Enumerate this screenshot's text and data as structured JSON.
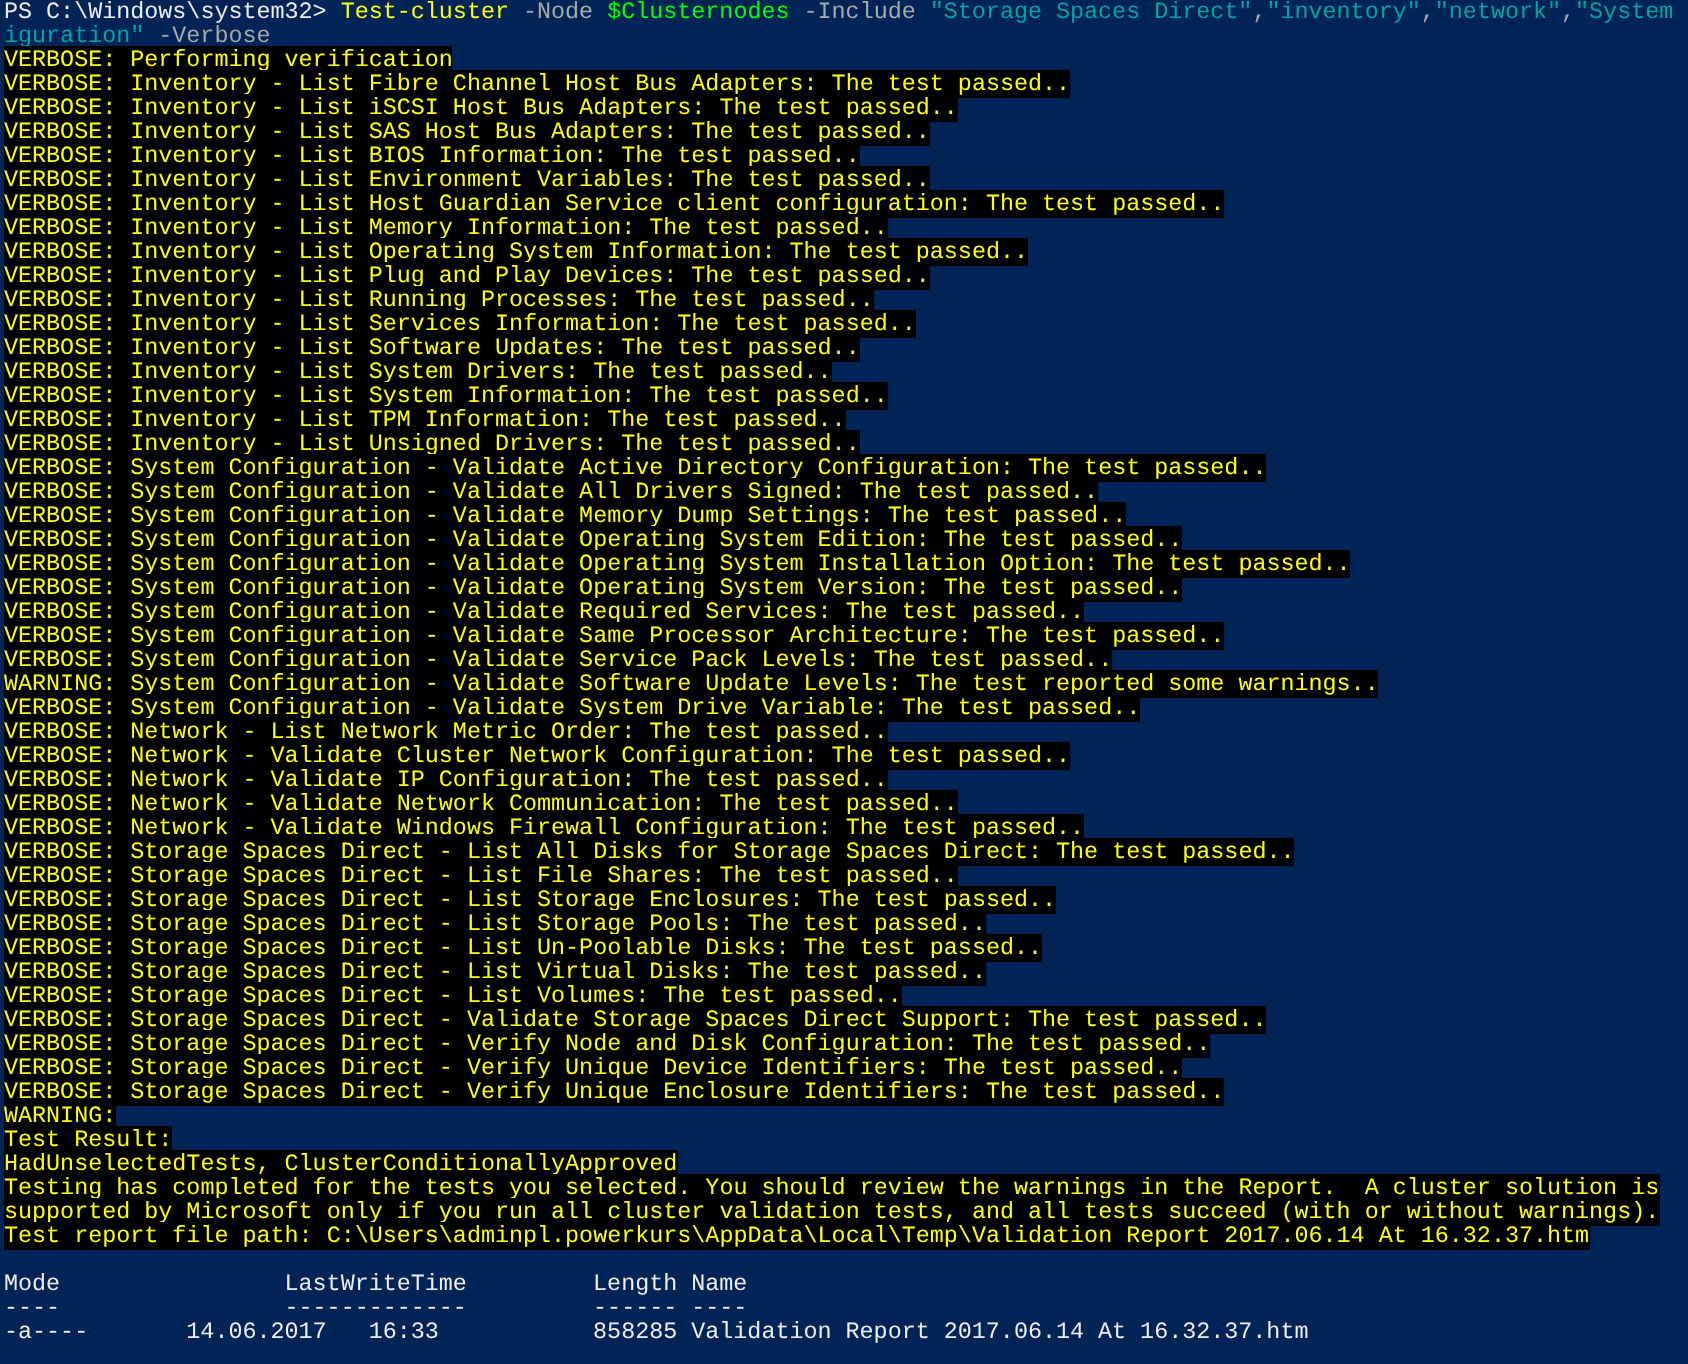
{
  "command_lines": [
    {
      "tokens": [
        {
          "kind": "prompt",
          "text": "PS C:\\Windows\\system32>"
        },
        {
          "kind": "command",
          "text": "Test-cluster"
        },
        {
          "kind": "parameter",
          "text": "-Node"
        },
        {
          "kind": "variable",
          "text": "$Clusternodes"
        },
        {
          "kind": "parameter",
          "text": "-Include"
        },
        {
          "kind": "string",
          "text": "\"Storage Spaces Direct\""
        },
        {
          "kind": "operator",
          "text": ","
        },
        {
          "kind": "string",
          "text": "\"inventory\""
        },
        {
          "kind": "operator",
          "text": ","
        },
        {
          "kind": "string",
          "text": "\"network\""
        },
        {
          "kind": "operator",
          "text": ","
        },
        {
          "kind": "string",
          "text": "\"System"
        }
      ]
    },
    {
      "tokens": [
        {
          "kind": "string",
          "text": "iguration\""
        },
        {
          "kind": "parameter",
          "text": "-Verbose"
        }
      ]
    }
  ],
  "output": [
    "VERBOSE: Performing verification",
    "VERBOSE: Inventory - List Fibre Channel Host Bus Adapters: The test passed..",
    "VERBOSE: Inventory - List iSCSI Host Bus Adapters: The test passed..",
    "VERBOSE: Inventory - List SAS Host Bus Adapters: The test passed..",
    "VERBOSE: Inventory - List BIOS Information: The test passed..",
    "VERBOSE: Inventory - List Environment Variables: The test passed..",
    "VERBOSE: Inventory - List Host Guardian Service client configuration: The test passed..",
    "VERBOSE: Inventory - List Memory Information: The test passed..",
    "VERBOSE: Inventory - List Operating System Information: The test passed..",
    "VERBOSE: Inventory - List Plug and Play Devices: The test passed..",
    "VERBOSE: Inventory - List Running Processes: The test passed..",
    "VERBOSE: Inventory - List Services Information: The test passed..",
    "VERBOSE: Inventory - List Software Updates: The test passed..",
    "VERBOSE: Inventory - List System Drivers: The test passed..",
    "VERBOSE: Inventory - List System Information: The test passed..",
    "VERBOSE: Inventory - List TPM Information: The test passed..",
    "VERBOSE: Inventory - List Unsigned Drivers: The test passed..",
    "VERBOSE: System Configuration - Validate Active Directory Configuration: The test passed..",
    "VERBOSE: System Configuration - Validate All Drivers Signed: The test passed..",
    "VERBOSE: System Configuration - Validate Memory Dump Settings: The test passed..",
    "VERBOSE: System Configuration - Validate Operating System Edition: The test passed..",
    "VERBOSE: System Configuration - Validate Operating System Installation Option: The test passed..",
    "VERBOSE: System Configuration - Validate Operating System Version: The test passed..",
    "VERBOSE: System Configuration - Validate Required Services: The test passed..",
    "VERBOSE: System Configuration - Validate Same Processor Architecture: The test passed..",
    "VERBOSE: System Configuration - Validate Service Pack Levels: The test passed..",
    "WARNING: System Configuration - Validate Software Update Levels: The test reported some warnings..",
    "VERBOSE: System Configuration - Validate System Drive Variable: The test passed..",
    "VERBOSE: Network - List Network Metric Order: The test passed..",
    "VERBOSE: Network - Validate Cluster Network Configuration: The test passed..",
    "VERBOSE: Network - Validate IP Configuration: The test passed..",
    "VERBOSE: Network - Validate Network Communication: The test passed..",
    "VERBOSE: Network - Validate Windows Firewall Configuration: The test passed..",
    "VERBOSE: Storage Spaces Direct - List All Disks for Storage Spaces Direct: The test passed..",
    "VERBOSE: Storage Spaces Direct - List File Shares: The test passed..",
    "VERBOSE: Storage Spaces Direct - List Storage Enclosures: The test passed..",
    "VERBOSE: Storage Spaces Direct - List Storage Pools: The test passed..",
    "VERBOSE: Storage Spaces Direct - List Un-Poolable Disks: The test passed..",
    "VERBOSE: Storage Spaces Direct - List Virtual Disks: The test passed..",
    "VERBOSE: Storage Spaces Direct - List Volumes: The test passed..",
    "VERBOSE: Storage Spaces Direct - Validate Storage Spaces Direct Support: The test passed..",
    "VERBOSE: Storage Spaces Direct - Verify Node and Disk Configuration: The test passed..",
    "VERBOSE: Storage Spaces Direct - Verify Unique Device Identifiers: The test passed..",
    "VERBOSE: Storage Spaces Direct - Verify Unique Enclosure Identifiers: The test passed..",
    "WARNING:",
    "Test Result:",
    "HadUnselectedTests, ClusterConditionallyApproved",
    "Testing has completed for the tests you selected. You should review the warnings in the Report.  A cluster solution is",
    "supported by Microsoft only if you run all cluster validation tests, and all tests succeed (with or without warnings).",
    "Test report file path: C:\\Users\\adminpl.powerkurs\\AppData\\Local\\Temp\\Validation Report 2017.06.14 At 16.32.37.htm"
  ],
  "table": {
    "columns": [
      "Mode",
      "LastWriteTime",
      "Length",
      "Name"
    ],
    "separators": [
      "----",
      "-------------",
      "------",
      "----"
    ],
    "rows": [
      {
        "mode": "-a----",
        "date": "14.06.2017",
        "time": "16:33",
        "length": "858285",
        "name": "Validation Report 2017.06.14 At 16.32.37.htm"
      }
    ]
  }
}
